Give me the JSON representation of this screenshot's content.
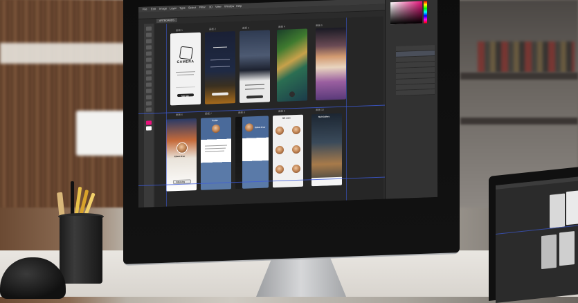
{
  "scene": {
    "description_key": "photo",
    "objects": [
      "imac",
      "laptop",
      "pen-cup",
      "headphones"
    ]
  },
  "photoshop": {
    "document_tab": "ARTBOARDS",
    "menu": [
      "File",
      "Edit",
      "Image",
      "Layer",
      "Type",
      "Select",
      "Filter",
      "3D",
      "View",
      "Window",
      "Help"
    ],
    "artboard_labels": [
      "画板 1",
      "画板 2",
      "画板 3",
      "画板 4",
      "画板 5",
      "画板 6",
      "画板 7",
      "画板 8",
      "画板 9",
      "画板 10"
    ],
    "accent_color": "#3d5bd9"
  },
  "artboards": {
    "camera": {
      "title": "CAMERA",
      "button": "Sign Up"
    },
    "profile": {
      "name": "Edvan Dsar",
      "follow": "Following"
    },
    "profile_header": "Profile",
    "calendar_name": "Edvan Dsar",
    "list_header": "MK Lists",
    "forest_header": "Mult Gallery"
  }
}
